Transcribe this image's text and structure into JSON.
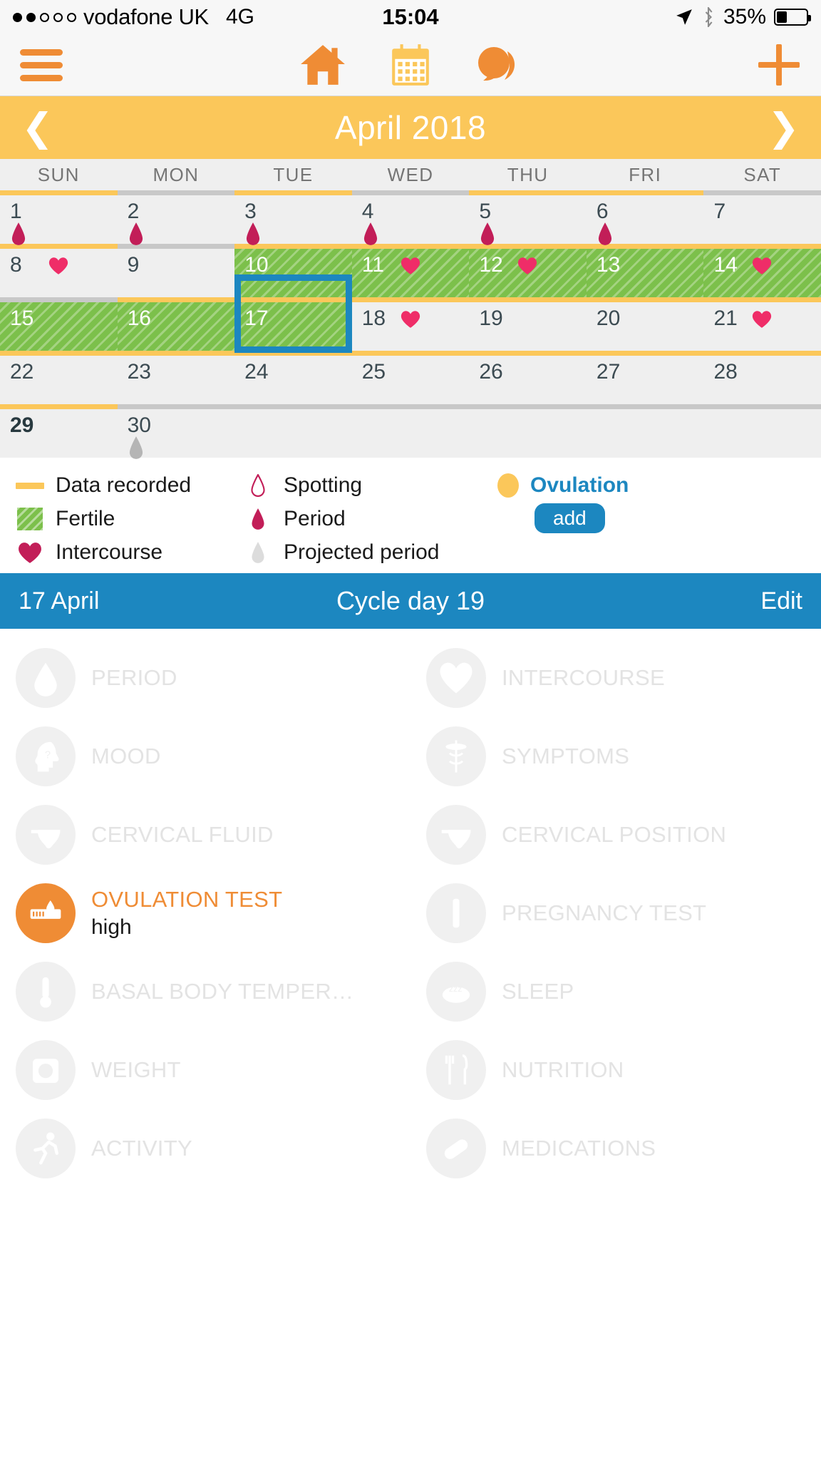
{
  "statusbar": {
    "signal_dots": [
      true,
      true,
      false,
      false,
      false
    ],
    "carrier": "vodafone UK",
    "network": "4G",
    "time": "15:04",
    "battery_pct": "35%",
    "location_icon": "location-arrow-icon",
    "bluetooth_icon": "bluetooth-icon"
  },
  "navbar": {
    "menu_icon": "hamburger-menu-icon",
    "home_icon": "home-icon",
    "calendar_icon": "calendar-icon",
    "chat_icon": "chat-bubble-icon",
    "add_icon": "plus-icon"
  },
  "month": {
    "title": "April 2018",
    "prev_icon": "chevron-left-icon",
    "next_icon": "chevron-right-icon"
  },
  "weekdays": [
    "SUN",
    "MON",
    "TUE",
    "WED",
    "THU",
    "FRI",
    "SAT"
  ],
  "calendar": {
    "selected_day": 17,
    "today": 29,
    "weeks": [
      [
        {
          "day": "1",
          "bar": "rec",
          "period": true
        },
        {
          "day": "2",
          "bar": "none",
          "period": true
        },
        {
          "day": "3",
          "bar": "rec",
          "period": true
        },
        {
          "day": "4",
          "bar": "none",
          "period": true
        },
        {
          "day": "5",
          "bar": "rec",
          "period": true
        },
        {
          "day": "6",
          "bar": "rec",
          "period": true
        },
        {
          "day": "7",
          "bar": "none"
        }
      ],
      [
        {
          "day": "8",
          "bar": "rec",
          "intercourse": true
        },
        {
          "day": "9",
          "bar": "none"
        },
        {
          "day": "10",
          "bar": "rec",
          "fertile": true
        },
        {
          "day": "11",
          "bar": "rec",
          "fertile": true,
          "intercourse": true
        },
        {
          "day": "12",
          "bar": "rec",
          "fertile": true,
          "intercourse": true
        },
        {
          "day": "13",
          "bar": "rec",
          "fertile": true
        },
        {
          "day": "14",
          "bar": "rec",
          "fertile": true,
          "intercourse": true
        }
      ],
      [
        {
          "day": "15",
          "bar": "none",
          "fertile": true
        },
        {
          "day": "16",
          "bar": "rec",
          "fertile": true
        },
        {
          "day": "17",
          "bar": "rec",
          "fertile": true,
          "selected": true
        },
        {
          "day": "18",
          "bar": "rec",
          "intercourse": true
        },
        {
          "day": "19",
          "bar": "rec"
        },
        {
          "day": "20",
          "bar": "rec"
        },
        {
          "day": "21",
          "bar": "rec",
          "intercourse": true
        }
      ],
      [
        {
          "day": "22",
          "bar": "rec"
        },
        {
          "day": "23",
          "bar": "rec"
        },
        {
          "day": "24",
          "bar": "rec"
        },
        {
          "day": "25",
          "bar": "rec"
        },
        {
          "day": "26",
          "bar": "rec"
        },
        {
          "day": "27",
          "bar": "rec"
        },
        {
          "day": "28",
          "bar": "rec"
        }
      ],
      [
        {
          "day": "29",
          "bar": "rec",
          "today": true
        },
        {
          "day": "30",
          "bar": "none",
          "projected": true
        },
        {
          "day": "",
          "bar": "none"
        },
        {
          "day": "",
          "bar": "none"
        },
        {
          "day": "",
          "bar": "none"
        },
        {
          "day": "",
          "bar": "none"
        },
        {
          "day": "",
          "bar": "none"
        }
      ]
    ]
  },
  "legend": {
    "col1": [
      {
        "label": "Data recorded",
        "icon": "yellow-bar-swatch"
      },
      {
        "label": "Fertile",
        "icon": "green-hatch-swatch"
      },
      {
        "label": "Intercourse",
        "icon": "heart-icon"
      }
    ],
    "col2": [
      {
        "label": "Spotting",
        "icon": "spotting-drop-icon"
      },
      {
        "label": "Period",
        "icon": "period-drop-icon"
      },
      {
        "label": "Projected period",
        "icon": "projected-drop-icon"
      }
    ],
    "ovulation": {
      "label": "Ovulation",
      "icon": "ovulation-dot-icon",
      "add_label": "add"
    }
  },
  "daybar": {
    "date": "17 April",
    "cycle": "Cycle day 19",
    "edit": "Edit"
  },
  "tracker": {
    "rows": [
      [
        {
          "label": "PERIOD",
          "icon": "period-drop-icon",
          "active": false
        },
        {
          "label": "INTERCOURSE",
          "icon": "heart-icon",
          "active": false
        }
      ],
      [
        {
          "label": "MOOD",
          "icon": "mood-head-icon",
          "active": false
        },
        {
          "label": "SYMPTOMS",
          "icon": "caduceus-icon",
          "active": false
        }
      ],
      [
        {
          "label": "CERVICAL FLUID",
          "icon": "underwear-icon",
          "active": false
        },
        {
          "label": "CERVICAL POSITION",
          "icon": "underwear-icon",
          "active": false
        }
      ],
      [
        {
          "label": "OVULATION TEST",
          "icon": "ovulation-test-icon",
          "active": true,
          "value": "high"
        },
        {
          "label": "PREGNANCY TEST",
          "icon": "pregnancy-test-icon",
          "active": false
        }
      ],
      [
        {
          "label": "BASAL BODY TEMPER…",
          "icon": "thermometer-icon",
          "active": false
        },
        {
          "label": "SLEEP",
          "icon": "sleep-zzz-icon",
          "active": false
        }
      ],
      [
        {
          "label": "WEIGHT",
          "icon": "scale-icon",
          "active": false
        },
        {
          "label": "NUTRITION",
          "icon": "fork-knife-icon",
          "active": false
        }
      ],
      [
        {
          "label": "ACTIVITY",
          "icon": "runner-icon",
          "active": false
        },
        {
          "label": "MEDICATIONS",
          "icon": "pill-icon",
          "active": false
        }
      ]
    ]
  }
}
